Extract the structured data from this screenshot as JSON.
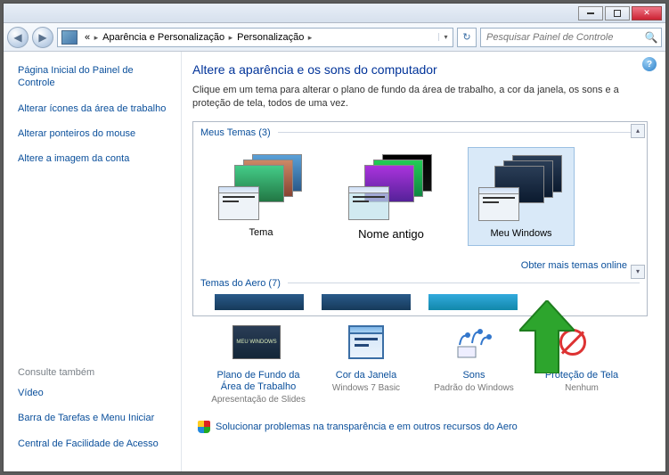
{
  "breadcrumb": {
    "seg1": "Aparência e Personalização",
    "seg2": "Personalização"
  },
  "search": {
    "placeholder": "Pesquisar Painel de Controle"
  },
  "sidebar": {
    "links": [
      "Página Inicial do Painel de Controle",
      "Alterar ícones da área de trabalho",
      "Alterar ponteiros do mouse",
      "Altere a imagem da conta"
    ],
    "see_also_label": "Consulte também",
    "see_also": [
      "Vídeo",
      "Barra de Tarefas e Menu Iniciar",
      "Central de Facilidade de Acesso"
    ]
  },
  "page": {
    "title": "Altere a aparência e os sons do computador",
    "desc": "Clique em um tema para alterar o plano de fundo da área de trabalho, a cor da janela, os sons e a proteção de tela, todos de uma vez."
  },
  "themes": {
    "my_label": "Meus Temas (3)",
    "items": [
      "Tema",
      "Nome antigo",
      "Meu Windows"
    ],
    "more_link": "Obter mais temas online",
    "aero_label": "Temas do Aero (7)"
  },
  "bottom": [
    {
      "label": "Plano de Fundo da Área de Trabalho",
      "sub": "Apresentação de Slides"
    },
    {
      "label": "Cor da Janela",
      "sub": "Windows 7 Basic"
    },
    {
      "label": "Sons",
      "sub": "Padrão do Windows"
    },
    {
      "label": "Proteção de Tela",
      "sub": "Nenhum"
    }
  ],
  "troubleshoot": "Solucionar problemas na transparência e em outros recursos do Aero"
}
